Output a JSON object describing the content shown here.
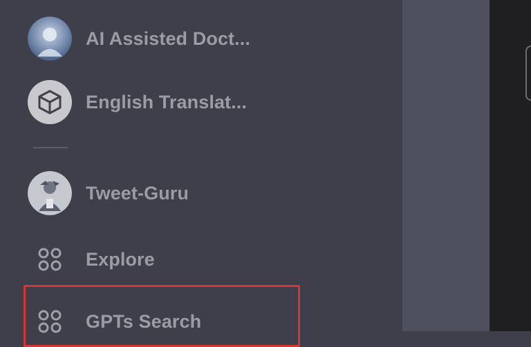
{
  "sidebar": {
    "items": [
      {
        "label": "AI Assisted Doct...",
        "icon": "doctor-avatar-icon"
      },
      {
        "label": "English Translat...",
        "icon": "cube-icon"
      },
      {
        "label": "Tweet-Guru",
        "icon": "tweet-guru-avatar-icon"
      },
      {
        "label": "Explore",
        "icon": "grid-circles-icon"
      },
      {
        "label": "GPTs Search",
        "icon": "grid-circles-icon"
      }
    ]
  },
  "colors": {
    "sidebar_bg": "#3e3f4b",
    "gutter_bg": "#4f505e",
    "main_bg": "#1f1f22",
    "label": "#9c9ca6",
    "highlight": "#d93434"
  }
}
